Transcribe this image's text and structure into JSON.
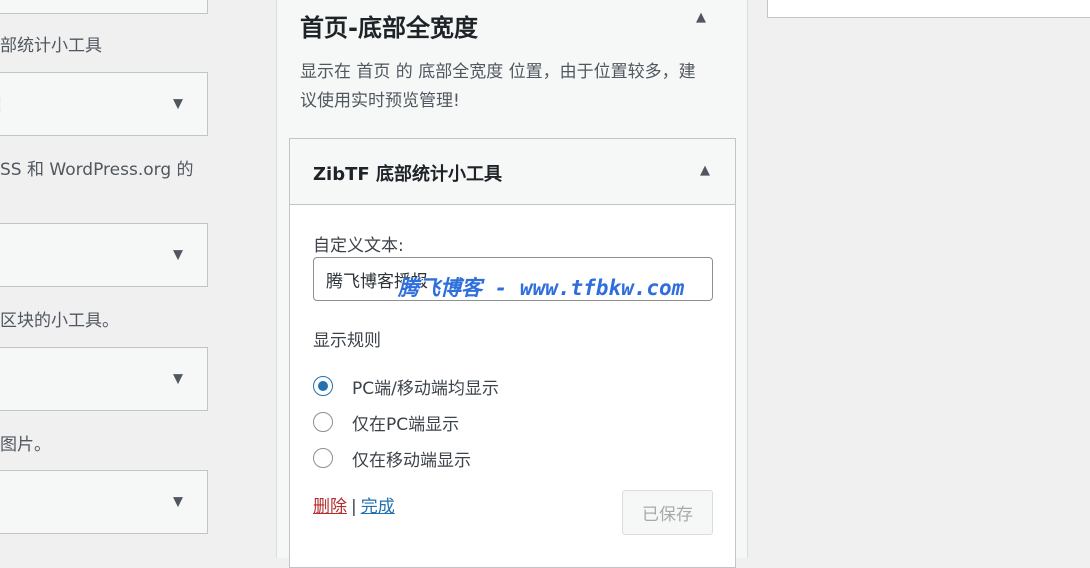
{
  "left_column": {
    "top_desc": "部统计小工具",
    "box2_title_fragment": "¦",
    "desc2": "SS 和 WordPress.org 的",
    "desc3": "区块的小工具。",
    "desc4": "图片。",
    "collapsed_arrow": "▼"
  },
  "sidebar": {
    "title": "首页-底部全宽度",
    "collapse_arrow": "▲",
    "description": "显示在 首页 的 底部全宽度 位置，由于位置较多，建议使用实时预览管理!"
  },
  "widget": {
    "title": "ZibTF 底部统计小工具",
    "toggle_arrow": "▲",
    "text_label": "自定义文本:",
    "text_value": "腾飞博客播报",
    "watermark": "腾飞博客 - www.tfbkw.com",
    "rules_label": "显示规则",
    "display_rules": [
      {
        "label": "PC端/移动端均显示",
        "checked": true
      },
      {
        "label": "仅在PC端显示",
        "checked": false
      },
      {
        "label": "仅在移动端显示",
        "checked": false
      }
    ],
    "delete_label": "删除",
    "separator": "|",
    "done_label": "完成",
    "save_label": "已保存"
  },
  "colors": {
    "accent": "#2271b1",
    "delete": "#b32d2e",
    "watermark": "#2f6fdc"
  }
}
